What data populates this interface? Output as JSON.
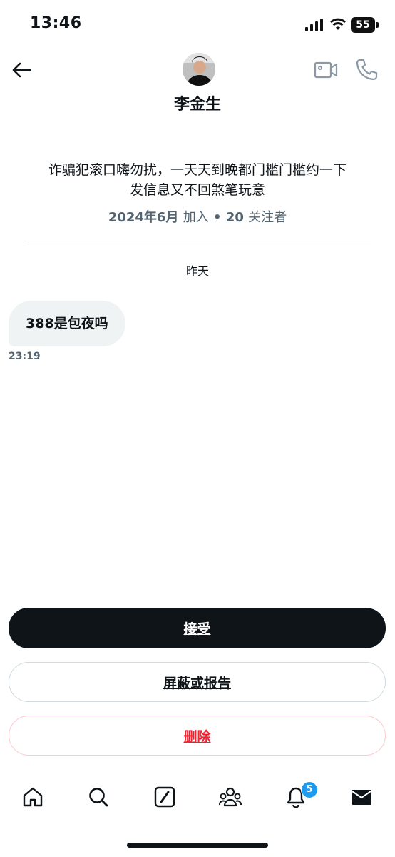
{
  "status_bar": {
    "time": "13:46",
    "battery": "55"
  },
  "header": {
    "name": "李金生"
  },
  "profile": {
    "bio_line1": "诈骗犯滚口嗨勿扰，一天天到晚都门槛门槛约一下",
    "bio_line2": "发信息又不回煞笔玩意",
    "joined": "2024年6月",
    "joined_suffix": "加入",
    "bullet": "•",
    "followers_count": "20",
    "followers_label": "关注者"
  },
  "conversation": {
    "date_separator": "昨天",
    "messages": [
      {
        "text": "388是包夜吗",
        "time": "23:19"
      }
    ]
  },
  "actions": {
    "accept": "接受",
    "block_report": "屏蔽或报告",
    "delete": "删除"
  },
  "bottom_nav": {
    "items": [
      "home-icon",
      "search-icon",
      "grok-icon",
      "communities-icon",
      "notifications-icon",
      "messages-icon"
    ],
    "notification_badge": "5"
  },
  "colors": {
    "accent": "#1d9bf0",
    "danger": "#f4212e",
    "text": "#0f1419",
    "secondary": "#536471"
  }
}
